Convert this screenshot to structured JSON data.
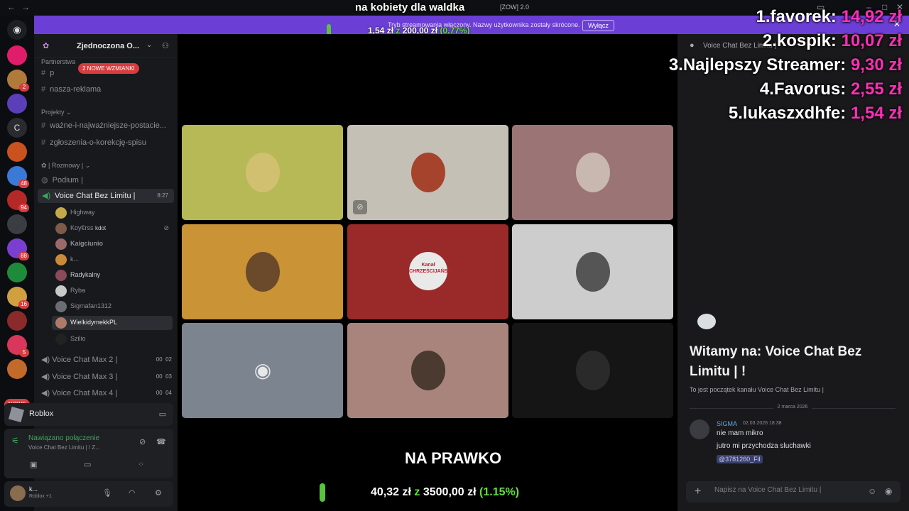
{
  "window": {
    "title": "[ZOW] 2.0",
    "overlay_title": "na kobiety dla waldka"
  },
  "banner": {
    "text": "Tryb streamowania włączony. Nazwy użytkownika zostały skrócone.",
    "button": "Wyłącz"
  },
  "goal_top": {
    "current": "1,54 zł",
    "z": "z",
    "target": "200,00 zł",
    "percent": "(0.77%)",
    "fraction": 0.0077
  },
  "leaderboard": [
    {
      "rank": "1.",
      "name": "favorek:",
      "amount": "14,92 zł"
    },
    {
      "rank": "2.",
      "name": "kospik:",
      "amount": "10,07 zł"
    },
    {
      "rank": "3.",
      "name": "Najlepszy Streamer:",
      "amount": "9,30 zł"
    },
    {
      "rank": "4.",
      "name": "Favorus:",
      "amount": "2,55 zł"
    },
    {
      "rank": "5.",
      "name": "lukaszxdhfe:",
      "amount": "1,54 zł"
    }
  ],
  "server_rail": {
    "letter_server": "C",
    "new_pill": "NOWE",
    "badges": [
      "2",
      "48",
      "94",
      "88",
      "16",
      "5"
    ]
  },
  "channels": {
    "server_name": "Zjednoczona O...",
    "mention_pill": "2 NOWE WZMIANKI",
    "partner_category": "Partnerstwa",
    "ch1": "p",
    "ch2": "nasza-reklama",
    "category_projects": "Projekty",
    "ch3": "ważne-i-najważniejsze-postacie...",
    "ch4": "zgłoszenia-o-korekcję-spisu",
    "category_talk": "Rozmowy",
    "podium": "Podium |",
    "active_vc": "Voice Chat Bez Limitu |",
    "active_vc_timer": "8:27",
    "members": [
      "Highway",
      "Koy€rss",
      "Kaigciunio",
      "k...",
      "Radykalny",
      "Ryba",
      "Sigmafan1312",
      "WielkidymekkPL",
      "Szilio"
    ],
    "member_extra": "kdot",
    "vc_max": [
      {
        "name": "Voice Chat Max 2 |",
        "a": "00",
        "b": "02"
      },
      {
        "name": "Voice Chat Max 3 |",
        "a": "00",
        "b": "03"
      },
      {
        "name": "Voice Chat Max 4 |",
        "a": "00",
        "b": "04"
      }
    ]
  },
  "activity": {
    "game": "Roblox",
    "connection_status": "Nawiązano połączenie",
    "connection_sub": "Voice Chat Bez Limitu | / Z...",
    "user_name": "k...",
    "user_activity": "Roblox +1"
  },
  "tiles": [
    {
      "bg": "#b6b956",
      "avatar": "#d0c070"
    },
    {
      "bg": "#c5c0b6",
      "avatar": "#a6432c",
      "muted": true
    },
    {
      "bg": "#9b7476",
      "avatar": "#c9b8b0"
    },
    {
      "bg": "#c99336",
      "avatar": "#6a4a2a"
    },
    {
      "bg": "#9a2a2a",
      "avatar": "#e9e9e9",
      "avatar_text": "Kanał CHRZEŚCIJAŃSKI"
    },
    {
      "bg": "#cdcdcd",
      "avatar": "#555"
    },
    {
      "bg": "#7c8490",
      "avatar": "discord"
    },
    {
      "bg": "#a8847c",
      "avatar": "#4a3a30"
    },
    {
      "bg": "#151515",
      "avatar": "#2a2a2a"
    }
  ],
  "stream_overlay": {
    "label": "NA PRAWKO",
    "goal_current": "40,32 zł",
    "goal_z": "z",
    "goal_target": "3500,00 zł",
    "goal_percent": "(1.15%)",
    "goal_fraction": 0.0115
  },
  "chat": {
    "header": "Voice Chat Bez Limitu |",
    "welcome": "Witamy na: Voice Chat Bez Limitu | !",
    "welcome_sub": "To jest początek kanału Voice Chat Bez Limitu |",
    "date": "2 marca 2026",
    "author": "SIGMA",
    "timestamp": "02.03.2026 18:38",
    "lines": [
      "nie mam mikro",
      "jutro mi przychodza sluchawki"
    ],
    "mention": "@3781260_Fil",
    "input_placeholder": "Napisz na Voice Chat Bez Limitu |"
  },
  "colors": {
    "banner": "#6b3fd6",
    "goal_green": "#5fe03a",
    "leaderboard_amount": "#ff2fb8"
  }
}
